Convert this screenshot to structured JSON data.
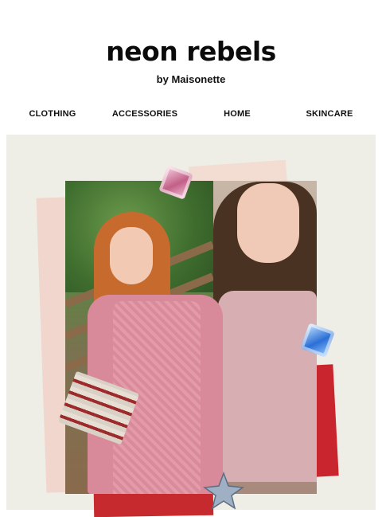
{
  "brand": {
    "title": "neon rebels",
    "subtitle": "by Maisonette"
  },
  "nav": {
    "items": [
      "CLOTHING",
      "ACCESSORIES",
      "HOME",
      "SKINCARE"
    ]
  },
  "hero": {
    "background_color": "#eeeee6",
    "accent_colors": [
      "#c9252e",
      "#f1d6cd"
    ],
    "decorations": [
      "pink-gem-icon",
      "blue-gem-icon",
      "silver-star-icon"
    ]
  }
}
